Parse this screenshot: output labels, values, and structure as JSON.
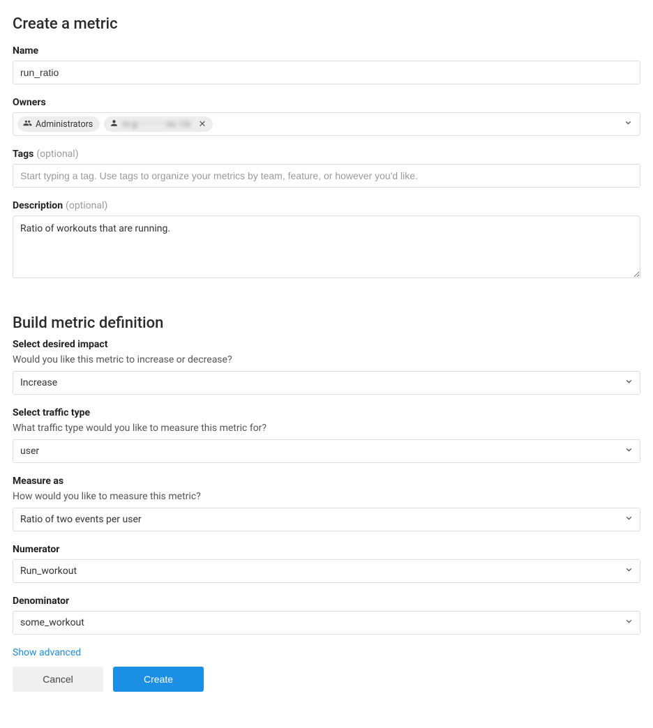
{
  "section1_title": "Create a metric",
  "section2_title": "Build metric definition",
  "name": {
    "label": "Name",
    "value": "run_ratio"
  },
  "owners": {
    "label": "Owners",
    "chips": [
      {
        "icon": "group",
        "text": "Administrators",
        "removable": false
      },
      {
        "icon": "person",
        "text": "m·g·············nc··l·b·",
        "removable": true,
        "blurred": true
      }
    ]
  },
  "tags": {
    "label": "Tags",
    "optional": "(optional)",
    "placeholder": "Start typing a tag. Use tags to organize your metrics by team, feature, or however you'd like."
  },
  "description": {
    "label": "Description",
    "optional": "(optional)",
    "value": "Ratio of workouts that are running."
  },
  "impact": {
    "label": "Select desired impact",
    "sub": "Would you like this metric to increase or decrease?",
    "value": "Increase"
  },
  "traffic": {
    "label": "Select traffic type",
    "sub": "What traffic type would you like to measure this metric for?",
    "value": "user"
  },
  "measure": {
    "label": "Measure as",
    "sub": "How would you like to measure this metric?",
    "value": "Ratio of two events per user"
  },
  "numerator": {
    "label": "Numerator",
    "value": "Run_workout"
  },
  "denominator": {
    "label": "Denominator",
    "value": "some_workout"
  },
  "show_advanced": "Show advanced",
  "buttons": {
    "cancel": "Cancel",
    "create": "Create"
  }
}
